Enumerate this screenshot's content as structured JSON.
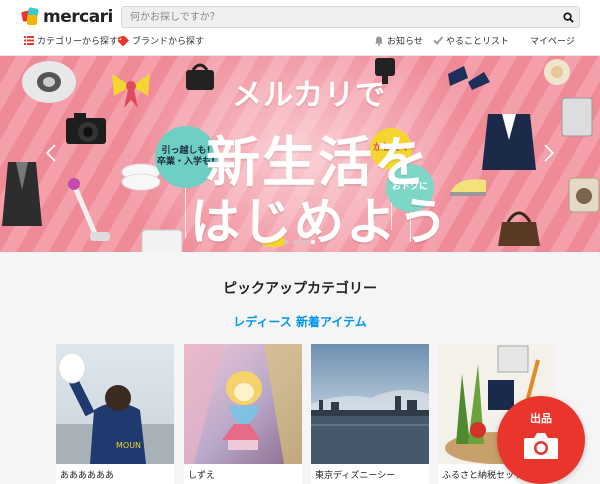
{
  "header": {
    "logo_text": "mercari",
    "search": {
      "placeholder": "何かお探しですか？",
      "value": ""
    }
  },
  "subnav": {
    "category": {
      "label": "カテゴリーから探す",
      "icon": "list-icon"
    },
    "brand": {
      "label": "ブランドから探す",
      "icon": "tag-icon"
    },
    "notifications": {
      "label": "お知らせ",
      "icon": "bell-icon"
    },
    "todo": {
      "label": "やることリスト",
      "icon": "check-icon"
    },
    "mypage": {
      "label": "マイページ"
    }
  },
  "banner": {
    "headline_1": "メルカリで",
    "headline_2": "新生活を",
    "headline_3": "はじめよう",
    "balloon_1": "引っ越しも!\n卒業・入学も!",
    "balloon_2": "かしこく",
    "balloon_3": "おトクに",
    "slide_count": 4,
    "active_slide": 4
  },
  "pickup": {
    "title": "ピックアップカテゴリー",
    "subtitle": "レディース 新着アイテム",
    "items": [
      {
        "caption": "ああああああ"
      },
      {
        "caption": "しずえ"
      },
      {
        "caption": "東京ディズニーシー"
      },
      {
        "caption": "ふるさと納税セット"
      }
    ]
  },
  "sell_button": {
    "label": "出品",
    "icon": "camera-icon"
  },
  "colors": {
    "brand_red": "#ea352d",
    "accent_blue": "#0095ee",
    "banner_pink": "#ef8a97"
  }
}
